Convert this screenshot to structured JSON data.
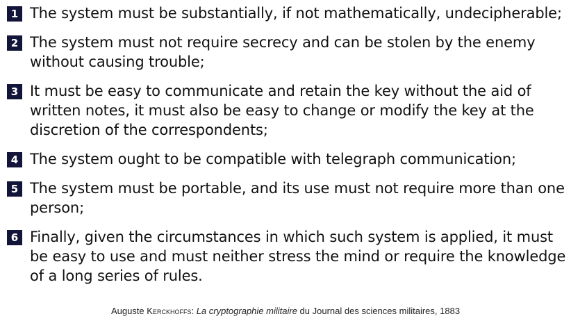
{
  "principles": [
    {
      "number": "1",
      "text": "The system must be substantially, if not mathematically, undecipherable;"
    },
    {
      "number": "2",
      "text": "The system must not require secrecy and can be stolen by the enemy without causing trouble;"
    },
    {
      "number": "3",
      "text": "It must be easy to communicate and retain the key without the aid of written notes, it must also be easy to change or modify the key at the discretion of the correspondents;"
    },
    {
      "number": "4",
      "text": "The system ought to be compatible with telegraph communication;"
    },
    {
      "number": "5",
      "text": "The system must be portable, and its use must not require more than one person;"
    },
    {
      "number": "6",
      "text": "Finally, given the circumstances in which such system is applied, it must be easy to use and must neither stress the mind or require the knowledge of a long series of rules."
    }
  ],
  "citation": {
    "author_first": "Auguste",
    "author_last": "Kerckhoffs:",
    "work_title": "La cryptographie militaire",
    "rest": "du Journal des sciences militaires, 1883"
  },
  "colors": {
    "number_badge_bg": "#13143a",
    "number_badge_fg": "#ffffff",
    "text": "#111111"
  }
}
